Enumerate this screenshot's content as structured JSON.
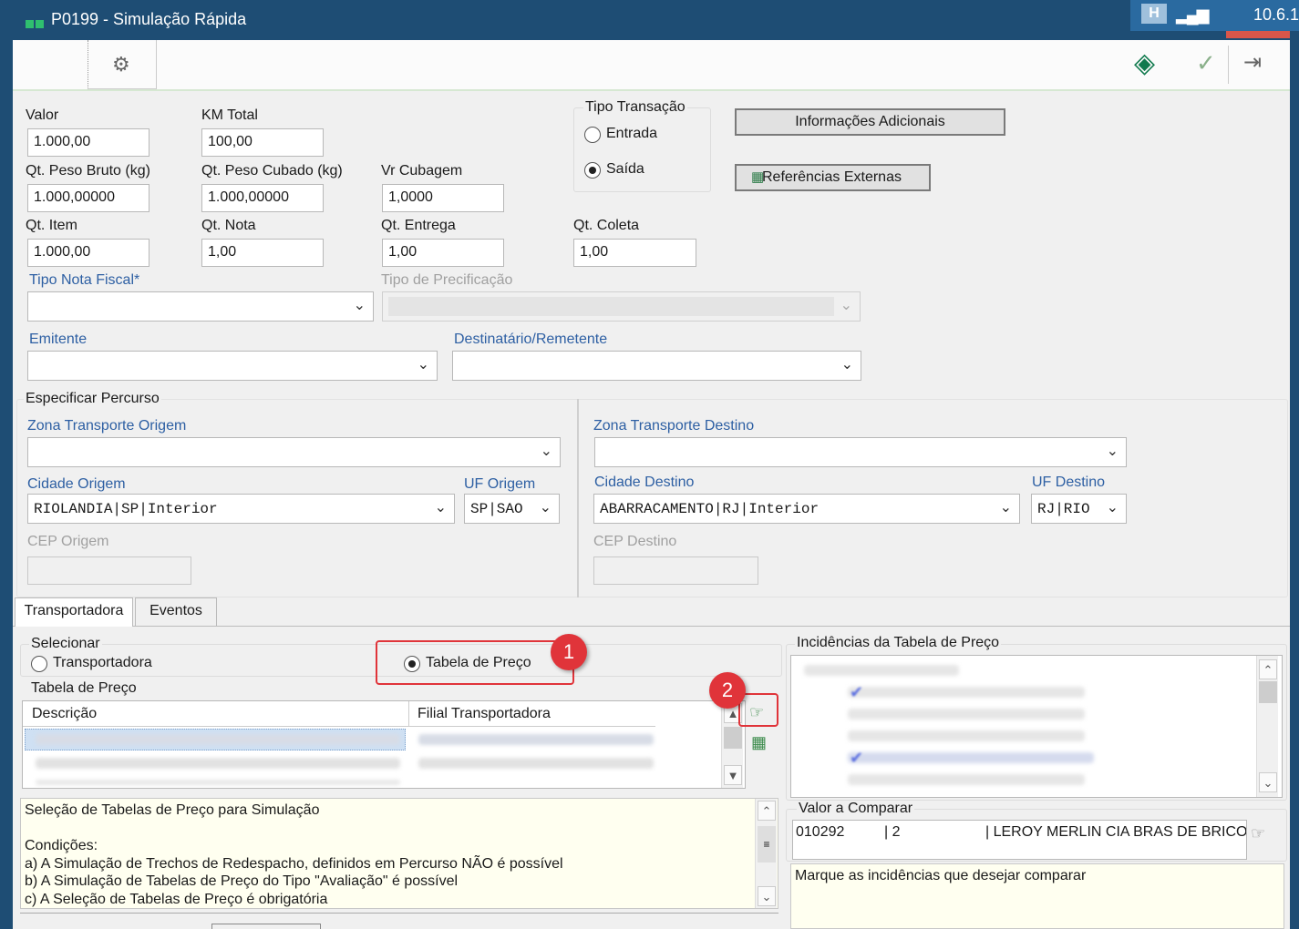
{
  "window": {
    "title": "P0199 - Simulação Rápida",
    "version": "10.6.1",
    "accent_color": "#1e4d74"
  },
  "toolbar": {
    "gear_icon": "gear-icon",
    "confirm_icon": "diamond-arrows-icon",
    "check_icon": "check-icon",
    "exit_icon": "exit-icon"
  },
  "form": {
    "valor": {
      "label": "Valor",
      "value": "1.000,00"
    },
    "km_total": {
      "label": "KM Total",
      "value": "100,00"
    },
    "peso_bruto": {
      "label": "Qt. Peso Bruto (kg)",
      "value": "1.000,00000"
    },
    "peso_cubado": {
      "label": "Qt. Peso Cubado (kg)",
      "value": "1.000,00000"
    },
    "vr_cubagem": {
      "label": "Vr Cubagem",
      "value": "1,0000"
    },
    "qt_item": {
      "label": "Qt. Item",
      "value": "1.000,00"
    },
    "qt_nota": {
      "label": "Qt. Nota",
      "value": "1,00"
    },
    "qt_entrega": {
      "label": "Qt. Entrega",
      "value": "1,00"
    },
    "qt_coleta": {
      "label": "Qt. Coleta",
      "value": "1,00"
    },
    "tipo_nota_fiscal": {
      "label": "Tipo Nota Fiscal*",
      "value": ""
    },
    "tipo_precificacao": {
      "label": "Tipo de Precificação",
      "value": ""
    },
    "emitente": {
      "label": "Emitente",
      "value": ""
    },
    "destinatario": {
      "label": "Destinatário/Remetente",
      "value": ""
    }
  },
  "tipo_transacao": {
    "label": "Tipo Transação",
    "options": [
      {
        "label": "Entrada",
        "selected": false
      },
      {
        "label": "Saída",
        "selected": true
      }
    ]
  },
  "buttons": {
    "info_adicionais": "Informações Adicionais",
    "referencias_externas": "Referências Externas"
  },
  "percurso": {
    "label": "Especificar Percurso",
    "zona_origem": {
      "label": "Zona Transporte Origem",
      "value": ""
    },
    "cidade_origem": {
      "label": "Cidade Origem",
      "value": "RIOLANDIA|SP|Interior"
    },
    "uf_origem": {
      "label": "UF Origem",
      "value": "SP|SAO"
    },
    "cep_origem": {
      "label": "CEP Origem",
      "value": ""
    },
    "zona_destino": {
      "label": "Zona Transporte Destino",
      "value": ""
    },
    "cidade_destino": {
      "label": "Cidade Destino",
      "value": "ABARRACAMENTO|RJ|Interior"
    },
    "uf_destino": {
      "label": "UF Destino",
      "value": "RJ|RIO"
    },
    "cep_destino": {
      "label": "CEP Destino",
      "value": ""
    }
  },
  "tabs": [
    {
      "label": "Transportadora",
      "active": true
    },
    {
      "label": "Eventos",
      "active": false
    }
  ],
  "selecionar": {
    "label": "Selecionar",
    "options": [
      {
        "label": "Transportadora",
        "selected": false
      },
      {
        "label": "Tabela de Preço",
        "selected": true
      }
    ]
  },
  "tabela_preco": {
    "label": "Tabela de Preço",
    "columns": [
      "Descrição",
      "Filial Transportadora"
    ]
  },
  "info_note": {
    "text": "Seleção de Tabelas de Preço para Simulação\n\nCondições:\na) A Simulação de Trechos de Redespacho, definidos em Percurso NÃO é possível\nb) A Simulação de Tabelas de Preço do Tipo \"Avaliação\" é possível\nc) A Seleção de Tabelas de Preço é obrigatória"
  },
  "incidencias": {
    "label": "Incidências da Tabela de Preço"
  },
  "valor_comparar": {
    "label": "Valor a Comparar",
    "code": "010292",
    "seq": "| 2",
    "name": "| LEROY MERLIN CIA BRAS DE BRICO"
  },
  "hint": {
    "text": "Marque as incidências que desejar comparar"
  },
  "callouts": [
    {
      "number": "1"
    },
    {
      "number": "2"
    }
  ]
}
